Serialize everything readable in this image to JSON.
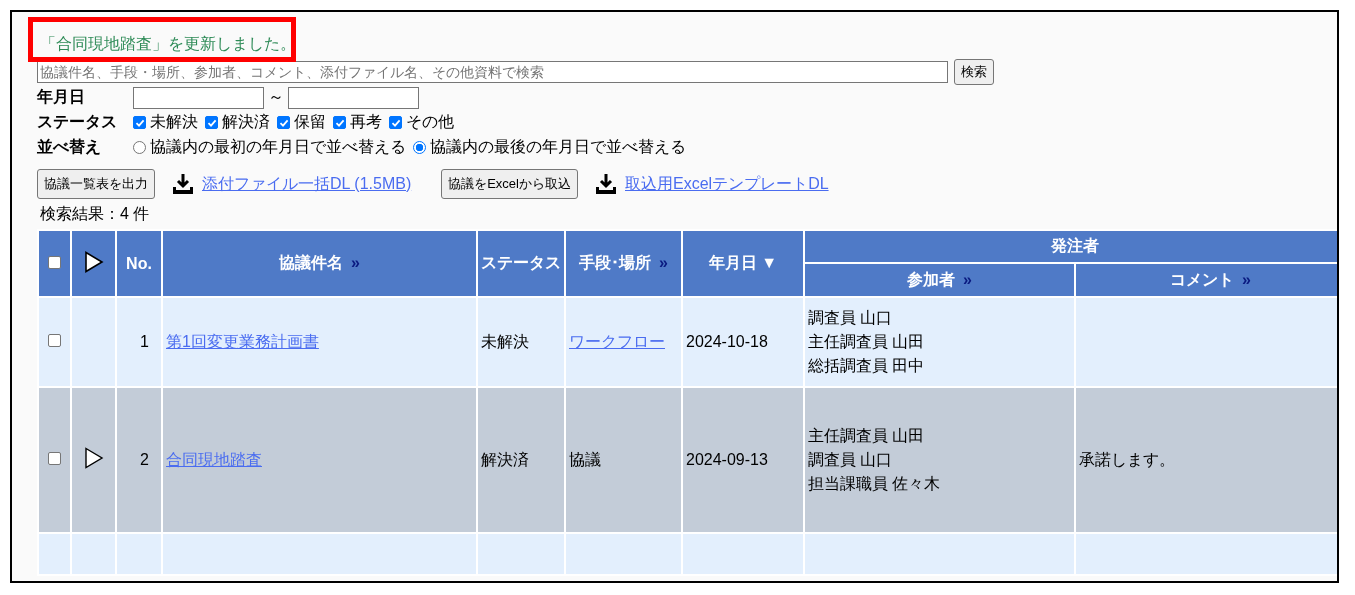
{
  "message": {
    "text": "「合同現地踏査」を更新しました。",
    "highlighted": true
  },
  "search": {
    "placeholder": "協議件名、手段・場所、参加者、コメント、添付ファイル名、その他資料で検索",
    "button": "検索"
  },
  "date_filter": {
    "label": "年月日",
    "separator": "～"
  },
  "status_filter": {
    "label": "ステータス",
    "options": [
      {
        "label": "未解決",
        "checked": true
      },
      {
        "label": "解決済",
        "checked": true
      },
      {
        "label": "保留",
        "checked": true
      },
      {
        "label": "再考",
        "checked": true
      },
      {
        "label": "その他",
        "checked": true
      }
    ]
  },
  "sort": {
    "label": "並べ替え",
    "options": [
      {
        "label": "協議内の最初の年月日で並べ替える",
        "selected": false
      },
      {
        "label": "協議内の最後の年月日で並べ替える",
        "selected": true
      }
    ]
  },
  "actions": [
    {
      "kind": "button",
      "label": "協議一覧表を出力"
    },
    {
      "kind": "download",
      "label": "添付ファイル一括DL (1.5MB)"
    },
    {
      "kind": "button",
      "label": "協議をExcelから取込"
    },
    {
      "kind": "download",
      "label": "取込用ExcelテンプレートDL"
    }
  ],
  "result_count": "検索結果：4 件",
  "table": {
    "select_all": {
      "checked": false
    },
    "columns": [
      {
        "label": "No."
      },
      {
        "label": "協議件名",
        "more": "»"
      },
      {
        "label": "ステータス"
      },
      {
        "label": "手段･場所",
        "more": "»"
      },
      {
        "label": "年月日 ▼"
      }
    ],
    "group": {
      "label": "発注者",
      "columns": [
        {
          "label": "参加者",
          "more": "»"
        },
        {
          "label": "コメント",
          "more": "»"
        }
      ]
    },
    "rows": [
      {
        "checked": false,
        "expandable": false,
        "highlighted": false,
        "no": "1",
        "title": "第1回変更業務計画書",
        "status": "未解決",
        "means": "ワークフロー",
        "means_link": true,
        "date": "2024-10-18",
        "participants": [
          "調査員 山口",
          "主任調査員 山田",
          "総括調査員 田中"
        ]
      },
      {
        "checked": false,
        "expandable": true,
        "highlighted": true,
        "no": "2",
        "title": "合同現地踏査",
        "status": "解決済",
        "means": "協議",
        "means_link": false,
        "date": "2024-09-13",
        "participants": [
          "主任調査員 山田",
          "調査員 山口",
          "担当課職員 佐々木"
        ],
        "comment": "承諾します。"
      }
    ]
  }
}
